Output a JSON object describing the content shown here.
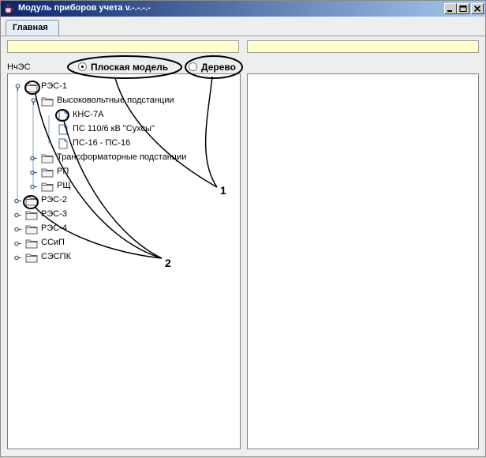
{
  "window": {
    "title": "Модуль приборов учета v.-.-.-.-"
  },
  "tabs": [
    {
      "label": "Главная"
    }
  ],
  "filter": {
    "label": "НчЭС"
  },
  "view_mode": {
    "options": [
      {
        "label": "Плоская модель",
        "selected": true
      },
      {
        "label": "Дерево",
        "selected": false
      }
    ]
  },
  "tree": {
    "nodes": [
      {
        "label": "РЭС-1",
        "level": 0,
        "kind": "folder",
        "expanded": true
      },
      {
        "label": "Высоковольтные подстанции",
        "level": 1,
        "kind": "folder",
        "expanded": true
      },
      {
        "label": "КНС-7А",
        "level": 2,
        "kind": "file"
      },
      {
        "label": "ПС 110/6 кВ \"Сухсы\"",
        "level": 2,
        "kind": "file"
      },
      {
        "label": "ПС-16 - ПС-16",
        "level": 2,
        "kind": "file"
      },
      {
        "label": "Трансформаторные подстанции",
        "level": 1,
        "kind": "folder",
        "expanded": false
      },
      {
        "label": "РП",
        "level": 1,
        "kind": "folder",
        "expanded": false
      },
      {
        "label": "РЩ",
        "level": 1,
        "kind": "folder",
        "expanded": false
      },
      {
        "label": "РЭС-2",
        "level": 0,
        "kind": "folder",
        "expanded": false
      },
      {
        "label": "РЭС-3",
        "level": 0,
        "kind": "folder",
        "expanded": false
      },
      {
        "label": "РЭС-4",
        "level": 0,
        "kind": "folder",
        "expanded": false
      },
      {
        "label": "ССиП",
        "level": 0,
        "kind": "folder",
        "expanded": false
      },
      {
        "label": "СЭСПК",
        "level": 0,
        "kind": "folder",
        "expanded": false
      }
    ]
  },
  "annotations": {
    "callout_1": "1",
    "callout_2": "2"
  },
  "colors": {
    "field_bg": "#ffffc8",
    "title_bar": "#0a246a"
  }
}
